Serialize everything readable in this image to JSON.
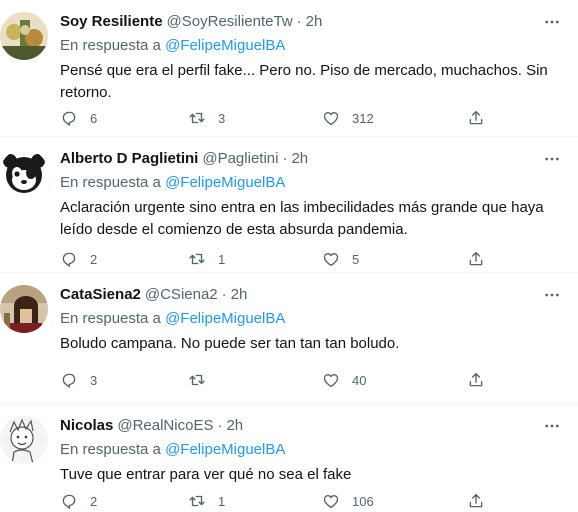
{
  "tweets": [
    {
      "name": "Soy Resiliente",
      "handle": "@SoyResilienteTw",
      "separator": "·",
      "time": "2h",
      "reply_prefix": "En respuesta a",
      "reply_to": "@FelipeMiguelBA",
      "text": "Pensé que era el perfil fake... Pero no. Piso de mercado, muchachos. Sin retorno.",
      "replies": "6",
      "retweets": "3",
      "likes": "312"
    },
    {
      "name": "Alberto D Paglietini",
      "handle": "@Paglietini",
      "separator": "·",
      "time": "2h",
      "reply_prefix": "En respuesta a",
      "reply_to": "@FelipeMiguelBA",
      "text": "Aclaración urgente sino entra en las imbecilidades más grande que haya leído desde el comienzo de esta absurda pandemia.",
      "replies": "2",
      "retweets": "1",
      "likes": "5"
    },
    {
      "name": "CataSiena2",
      "handle": "@CSiena2",
      "separator": "·",
      "time": "2h",
      "reply_prefix": "En respuesta a",
      "reply_to": "@FelipeMiguelBA",
      "text": "Boludo campana. No puede ser tan tan tan boludo.",
      "replies": "3",
      "retweets": "",
      "likes": "40"
    },
    {
      "name": "Nicolas",
      "handle": "@RealNicoES",
      "separator": "·",
      "time": "2h",
      "reply_prefix": "En respuesta a",
      "reply_to": "@FelipeMiguelBA",
      "text": "Tuve que entrar para ver qué no sea el fake",
      "replies": "2",
      "retweets": "1",
      "likes": "106"
    }
  ],
  "colors": {
    "text": "#0f1419",
    "muted": "#536471",
    "link": "#1d9bf0",
    "divider": "#eff3f4"
  },
  "icons": [
    "reply-icon",
    "retweet-icon",
    "like-icon",
    "share-icon",
    "more-icon"
  ]
}
